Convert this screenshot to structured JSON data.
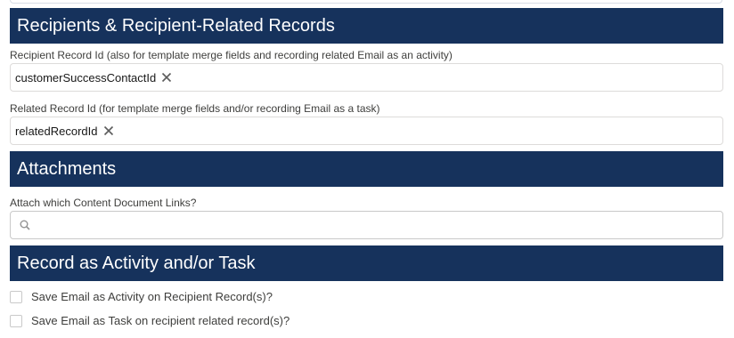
{
  "sections": {
    "recipients": {
      "title": "Recipients & Recipient-Related Records",
      "recipient_field": {
        "label": "Recipient Record Id (also for template merge fields and recording related Email as an activity)",
        "value": "customerSuccessContactId"
      },
      "related_field": {
        "label": "Related Record Id (for template merge fields and/or recording Email as a task)",
        "value": "relatedRecordId"
      }
    },
    "attachments": {
      "title": "Attachments",
      "links_field": {
        "label": "Attach which Content Document Links?",
        "placeholder": ""
      }
    },
    "record_activity": {
      "title": "Record as Activity and/or Task",
      "checkboxes": [
        {
          "label": "Save Email as Activity on Recipient Record(s)?",
          "checked": false
        },
        {
          "label": "Save Email as Task on recipient related record(s)?",
          "checked": false
        }
      ]
    }
  },
  "colors": {
    "header_bg": "#16325c",
    "header_text": "#ffffff",
    "border": "#dddbda"
  },
  "icons": {
    "remove": "close-icon",
    "search": "search-icon"
  }
}
